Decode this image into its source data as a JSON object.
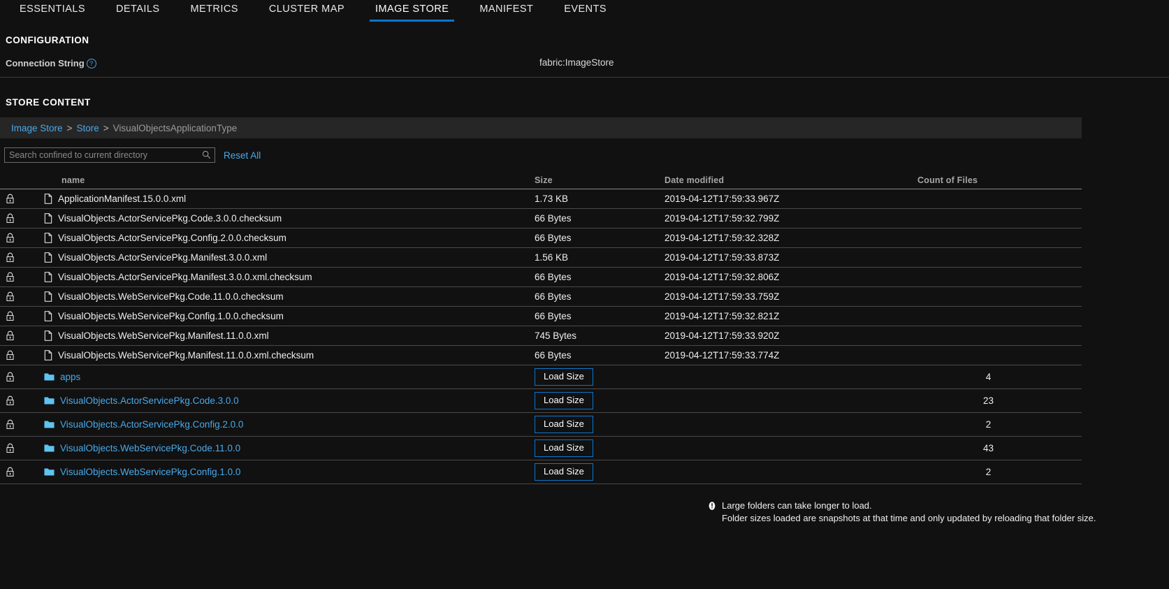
{
  "tabs": [
    {
      "label": "ESSENTIALS",
      "active": false
    },
    {
      "label": "DETAILS",
      "active": false
    },
    {
      "label": "METRICS",
      "active": false
    },
    {
      "label": "CLUSTER MAP",
      "active": false
    },
    {
      "label": "IMAGE STORE",
      "active": true
    },
    {
      "label": "MANIFEST",
      "active": false
    },
    {
      "label": "EVENTS",
      "active": false
    }
  ],
  "configuration": {
    "title": "CONFIGURATION",
    "connection_string_label": "Connection String",
    "help_glyph": "?",
    "connection_string_value": "fabric:ImageStore"
  },
  "store_content": {
    "title": "STORE CONTENT",
    "breadcrumb": [
      {
        "label": "Image Store",
        "link": true
      },
      {
        "label": "Store",
        "link": true
      },
      {
        "label": "VisualObjectsApplicationType",
        "link": false
      }
    ],
    "breadcrumb_separator": ">",
    "search_placeholder": "Search confined to current directory",
    "search_value": "",
    "reset_all_label": "Reset All",
    "columns": {
      "name": "name",
      "size": "Size",
      "date_modified": "Date modified",
      "count_of_files": "Count of Files"
    },
    "rows": [
      {
        "type": "file",
        "lock": true,
        "name": "ApplicationManifest.15.0.0.xml",
        "size": "1.73 KB",
        "date": "2019-04-12T17:59:33.967Z",
        "count": ""
      },
      {
        "type": "file",
        "lock": true,
        "name": "VisualObjects.ActorServicePkg.Code.3.0.0.checksum",
        "size": "66 Bytes",
        "date": "2019-04-12T17:59:32.799Z",
        "count": ""
      },
      {
        "type": "file",
        "lock": true,
        "name": "VisualObjects.ActorServicePkg.Config.2.0.0.checksum",
        "size": "66 Bytes",
        "date": "2019-04-12T17:59:32.328Z",
        "count": ""
      },
      {
        "type": "file",
        "lock": true,
        "name": "VisualObjects.ActorServicePkg.Manifest.3.0.0.xml",
        "size": "1.56 KB",
        "date": "2019-04-12T17:59:33.873Z",
        "count": ""
      },
      {
        "type": "file",
        "lock": true,
        "name": "VisualObjects.ActorServicePkg.Manifest.3.0.0.xml.checksum",
        "size": "66 Bytes",
        "date": "2019-04-12T17:59:32.806Z",
        "count": ""
      },
      {
        "type": "file",
        "lock": true,
        "name": "VisualObjects.WebServicePkg.Code.11.0.0.checksum",
        "size": "66 Bytes",
        "date": "2019-04-12T17:59:33.759Z",
        "count": ""
      },
      {
        "type": "file",
        "lock": true,
        "name": "VisualObjects.WebServicePkg.Config.1.0.0.checksum",
        "size": "66 Bytes",
        "date": "2019-04-12T17:59:32.821Z",
        "count": ""
      },
      {
        "type": "file",
        "lock": true,
        "name": "VisualObjects.WebServicePkg.Manifest.11.0.0.xml",
        "size": "745 Bytes",
        "date": "2019-04-12T17:59:33.920Z",
        "count": ""
      },
      {
        "type": "file",
        "lock": true,
        "name": "VisualObjects.WebServicePkg.Manifest.11.0.0.xml.checksum",
        "size": "66 Bytes",
        "date": "2019-04-12T17:59:33.774Z",
        "count": ""
      },
      {
        "type": "folder",
        "lock": true,
        "name": "apps",
        "size_button": "Load Size",
        "date": "",
        "count": "4"
      },
      {
        "type": "folder",
        "lock": true,
        "name": "VisualObjects.ActorServicePkg.Code.3.0.0",
        "size_button": "Load Size",
        "date": "",
        "count": "23"
      },
      {
        "type": "folder",
        "lock": true,
        "name": "VisualObjects.ActorServicePkg.Config.2.0.0",
        "size_button": "Load Size",
        "date": "",
        "count": "2"
      },
      {
        "type": "folder",
        "lock": true,
        "name": "VisualObjects.WebServicePkg.Code.11.0.0",
        "size_button": "Load Size",
        "date": "",
        "count": "43"
      },
      {
        "type": "folder",
        "lock": true,
        "name": "VisualObjects.WebServicePkg.Config.1.0.0",
        "size_button": "Load Size",
        "date": "",
        "count": "2"
      }
    ],
    "note": {
      "line1": "Large folders can take longer to load.",
      "line2": "Folder sizes loaded are snapshots at that time and only updated by reloading that folder size."
    }
  },
  "icons": {
    "lock": "lock-icon",
    "file": "file-icon",
    "folder": "folder-icon",
    "search": "search-icon",
    "help": "help-circle-icon",
    "info": "info-icon"
  },
  "colors": {
    "background": "#111111",
    "accent_blue": "#0b76cf",
    "link_blue": "#49a9ea",
    "folder_icon": "#5fc3f0",
    "row_divider": "#4a4a4a",
    "breadcrumb_bg": "#262626"
  }
}
